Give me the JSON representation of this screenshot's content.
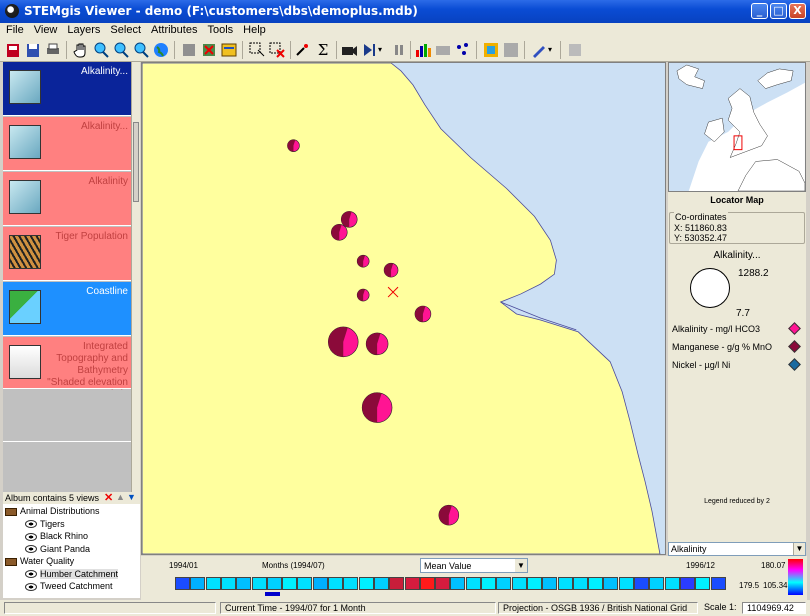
{
  "window": {
    "title": "STEMgis Viewer - demo (F:\\customers\\dbs\\demoplus.mdb)",
    "min": "_",
    "max": "□",
    "close": "X"
  },
  "menu": [
    "File",
    "View",
    "Layers",
    "Select",
    "Attributes",
    "Tools",
    "Help"
  ],
  "views": [
    {
      "label": "Alkalinity...",
      "bg": "#0a249a",
      "fg": "#ffffff",
      "icon": "flask-icon"
    },
    {
      "label": "Alkalinity...",
      "bg": "#ff8080",
      "fg": "#c04040",
      "icon": "flask-icon"
    },
    {
      "label": "Alkalinity",
      "bg": "#ff8080",
      "fg": "#c04040",
      "icon": "flask-icon"
    },
    {
      "label": "Tiger Population",
      "bg": "#ff8080",
      "fg": "#c04040",
      "icon": "tiger-icon"
    },
    {
      "label": "Coastline",
      "bg": "#1e90ff",
      "fg": "#ffffff",
      "icon": "coastline-icon"
    },
    {
      "label": "Integrated Topography and Bathymetry \"Shaded elevation (m)\"",
      "bg": "#ff8080",
      "fg": "#c04040",
      "icon": "trees-icon"
    }
  ],
  "album": {
    "text": "Album contains 5 views",
    "tree": [
      {
        "label": "Animal Distributions",
        "level": 0,
        "icon": "book-icon"
      },
      {
        "label": "Tigers",
        "level": 1,
        "icon": "eye-icon"
      },
      {
        "label": "Black Rhino",
        "level": 1,
        "icon": "eye-icon"
      },
      {
        "label": "Giant Panda",
        "level": 1,
        "icon": "eye-icon"
      },
      {
        "label": "Water Quality",
        "level": 0,
        "icon": "book-icon"
      },
      {
        "label": "Humber Catchment",
        "level": 1,
        "icon": "eye-icon",
        "selected": true
      },
      {
        "label": "Tweed Catchment",
        "level": 1,
        "icon": "eye-icon"
      }
    ]
  },
  "locator": {
    "title": "Locator Map",
    "coords_title": "Co-ordinates",
    "x": "X: 511860.83",
    "y": "Y: 530352.47"
  },
  "legend": {
    "title": "Alkalinity...",
    "max": "1288.2",
    "min": "7.7",
    "items": [
      {
        "label": "Alkalinity - mg/l HCO3",
        "color": "#ff1493"
      },
      {
        "label": "Manganese - g/g % MnO",
        "color": "#8b0a3a"
      },
      {
        "label": "Nickel - µg/l Ni",
        "color": "#1a6aa0"
      }
    ],
    "note": "Legend reduced by 2",
    "select": "Alkalinity"
  },
  "timebar": {
    "start": "1994/01",
    "months": "Months (1994/07)",
    "mode": "Mean Value",
    "end": "1996/12",
    "val_top": "180.07",
    "val_mid": "179.5",
    "val_bot": "105.34",
    "cells": [
      "#1a4cff",
      "#00b0ff",
      "#00e0ff",
      "#00e0ff",
      "#00c0ff",
      "#00e0ff",
      "#00d0ff",
      "#00f0ff",
      "#00e0ff",
      "#00b0ff",
      "#00e0ff",
      "#00e0ff",
      "#00f0ff",
      "#00d0ff",
      "#c81e3a",
      "#d61c3e",
      "#ff1a1a",
      "#d61c3e",
      "#00c0ff",
      "#00e0ff",
      "#00f0ff",
      "#00d0ff",
      "#00e0ff",
      "#00f0ff",
      "#00c0ff",
      "#00e0ff",
      "#00e0ff",
      "#00f0ff",
      "#00c0ff",
      "#00e0ff",
      "#1a4cff",
      "#00d0ff",
      "#00e0ff",
      "#2a3cff",
      "#00f0ff",
      "#1a4cff"
    ]
  },
  "status": {
    "time": "Current Time - 1994/07 for 1 Month",
    "projection": "Projection - OSGB 1936 / British National Grid",
    "scale_label": "Scale 1:",
    "scale": "1104969.42"
  }
}
